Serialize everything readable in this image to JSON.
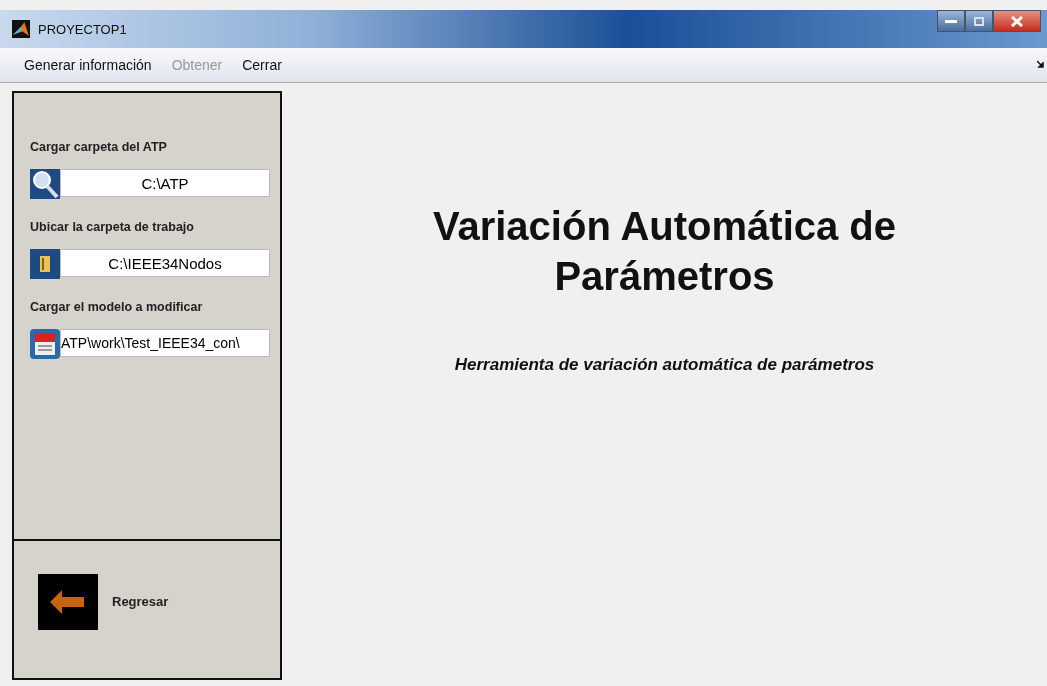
{
  "window": {
    "title": "PROYECTOP1"
  },
  "menu": [
    {
      "label": "Generar información",
      "disabled": false
    },
    {
      "label": "Obtener",
      "disabled": true
    },
    {
      "label": "Cerrar",
      "disabled": false
    }
  ],
  "sidebar": {
    "sections": [
      {
        "label": "Cargar carpeta del ATP",
        "value": "C:\\ATP",
        "kind": "search"
      },
      {
        "label": "Ubicar la carpeta de trabajo",
        "value": "C:\\IEEE34Nodos",
        "kind": "folder"
      },
      {
        "label": "Cargar el modelo a modificar",
        "value": "ATP\\work\\Test_IEEE34_con\\",
        "kind": "file"
      }
    ],
    "back_button": {
      "label": "Regresar"
    }
  },
  "main": {
    "title": "Variación Automática de Parámetros",
    "subtitle": "Herramienta de variación automática de parámetros"
  }
}
